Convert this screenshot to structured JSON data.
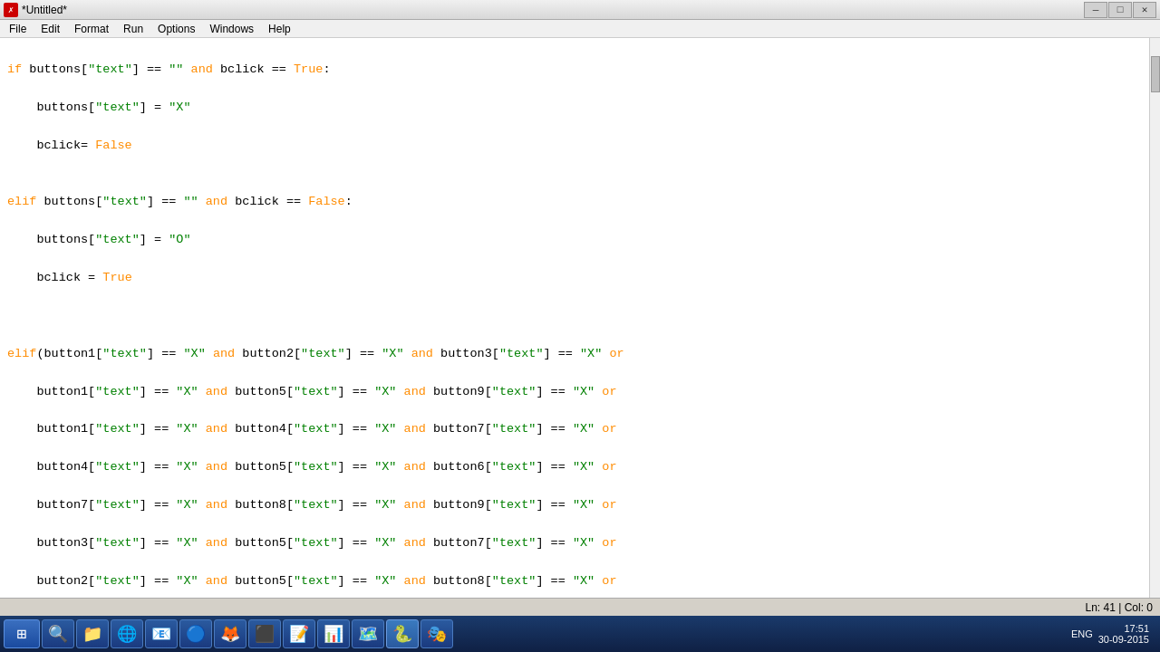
{
  "titleBar": {
    "icon": "✗",
    "title": "*Untitled*",
    "minimize": "—",
    "maximize": "□",
    "close": "✕"
  },
  "menuBar": {
    "items": [
      "File",
      "Edit",
      "Format",
      "Run",
      "Options",
      "Windows",
      "Help"
    ]
  },
  "statusBar": {
    "position": "Ln: 41 | Col: 0"
  },
  "taskbar": {
    "time": "17:51",
    "date": "30-09-2015",
    "lang": "ENG"
  }
}
